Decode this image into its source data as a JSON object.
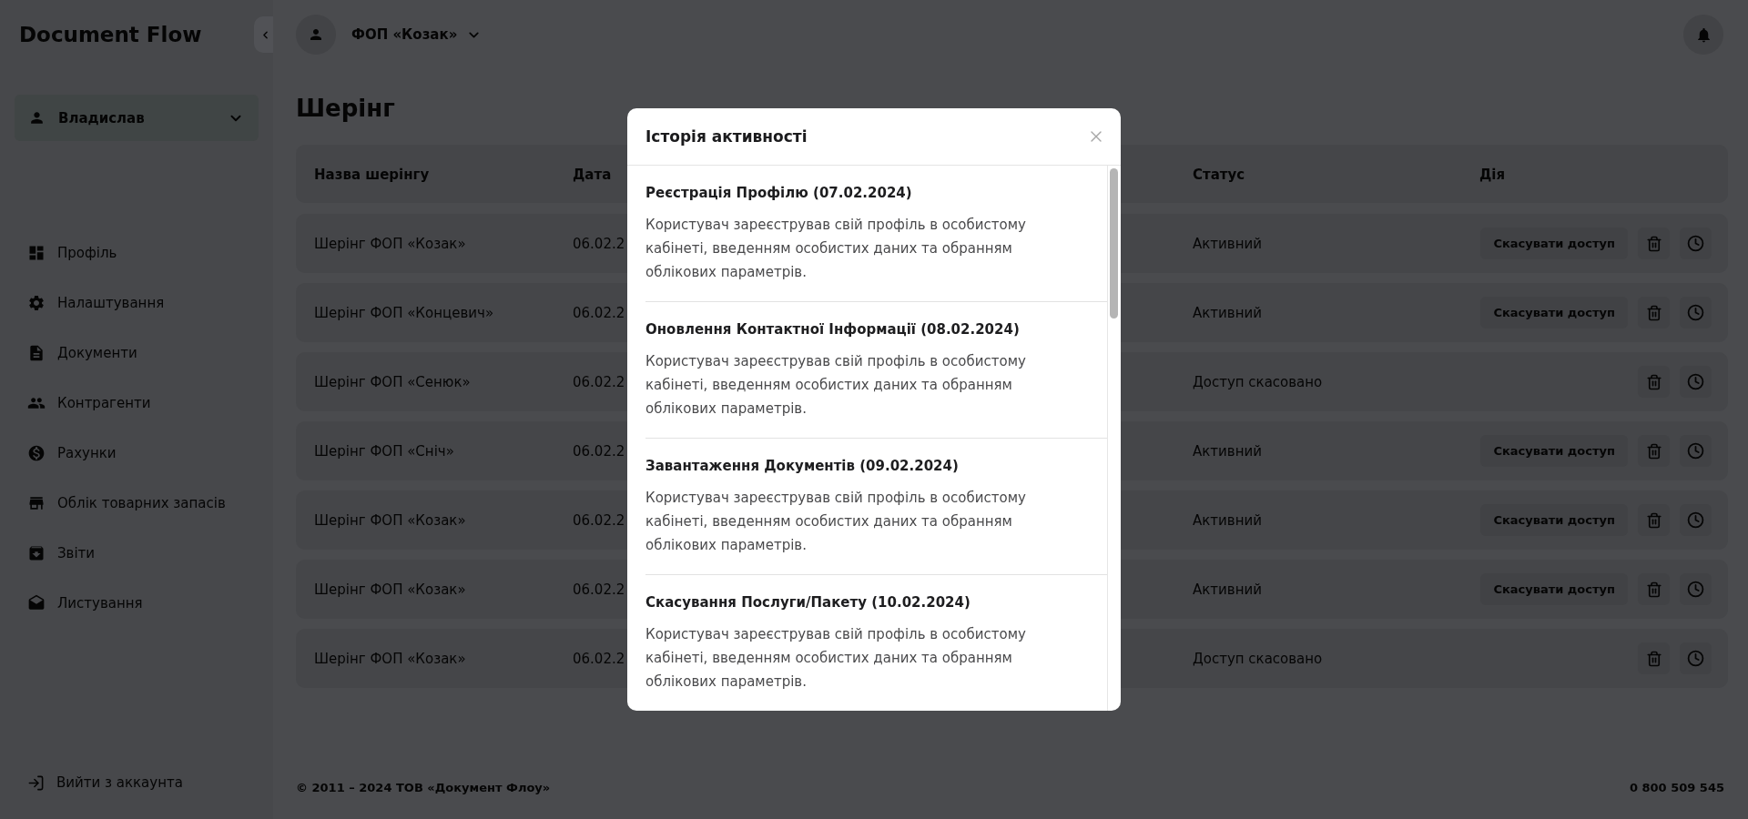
{
  "sidebar": {
    "logo": "Document Flow",
    "user_menu": "Владислав",
    "nav": [
      "Профіль",
      "Налаштування",
      "Документи",
      "Контрагенти",
      "Рахунки",
      "Облік товарних запасів",
      "Звіти",
      "Листування"
    ],
    "logout": "Вийти з аккаунта"
  },
  "topbar": {
    "company": "ФОП «Козак»"
  },
  "page_title": "Шерінг",
  "table": {
    "columns": [
      "Назва шерінгу",
      "Дата",
      "Статус",
      "Дія"
    ],
    "rows": [
      {
        "name": "Шерінг ФОП «Козак»",
        "date": "06.02.2",
        "status": "Активний",
        "revoke_button": "Скасувати доступ"
      },
      {
        "name": "Шерінг ФОП «Концевич»",
        "date": "06.02.2",
        "status": "Активний",
        "revoke_button": "Скасувати доступ"
      },
      {
        "name": "Шерінг ФОП «Сенюк»",
        "date": "06.02.2",
        "status": "Доступ скасовано"
      },
      {
        "name": "Шерінг ФОП «Сніч»",
        "date": "06.02.2",
        "status": "Активний",
        "revoke_button": "Скасувати доступ"
      },
      {
        "name": "Шерінг ФОП «Козак»",
        "date": "06.02.2",
        "status": "Активний",
        "revoke_button": "Скасувати доступ"
      },
      {
        "name": "Шерінг ФОП «Козак»",
        "date": "06.02.2",
        "status": "Активний",
        "revoke_button": "Скасувати доступ"
      },
      {
        "name": "Шерінг ФОП «Козак»",
        "date": "06.02.2",
        "status": "Доступ скасовано"
      }
    ]
  },
  "footer": {
    "copyright": "© 2011 – 2024 ТОВ «Документ Флоу»",
    "phone": "0 800 509 545"
  },
  "modal": {
    "title": "Історія активності",
    "entries": [
      {
        "title": "Реєстрація Профілю (07.02.2024)",
        "text": "Користувач зареєстрував свій профіль в особистому кабінеті, введенням особистих даних та обранням облікових параметрів."
      },
      {
        "title": "Оновлення Контактної Інформації (08.02.2024)",
        "text": "Користувач зареєстрував свій профіль в особистому кабінеті, введенням особистих даних та обранням облікових параметрів."
      },
      {
        "title": "Завантаження Документів (09.02.2024)",
        "text": "Користувач зареєстрував свій профіль в особистому кабінеті, введенням особистих даних та обранням облікових параметрів."
      },
      {
        "title": "Скасування Послуги/Пакету (10.02.2024)",
        "text": "Користувач зареєстрував свій профіль в особистому кабінеті, введенням особистих даних та обранням облікових параметрів."
      }
    ]
  }
}
